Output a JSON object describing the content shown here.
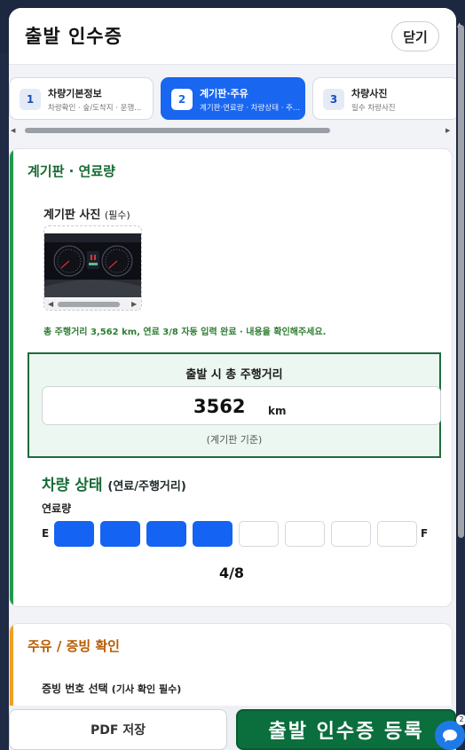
{
  "modal": {
    "title": "출발 인수증",
    "close_label": "닫기"
  },
  "steps": [
    {
      "num": "1",
      "title": "차량기본정보",
      "sub": "차량확인 · 숲/도착지 · 운행...",
      "active": false
    },
    {
      "num": "2",
      "title": "계기판·주유",
      "sub": "계기판·연료량 · 차량상태 · 주...",
      "active": true
    },
    {
      "num": "3",
      "title": "차량사진",
      "sub": "필수 차량사진",
      "active": false
    }
  ],
  "dashboard": {
    "section_title": "계기판 · 연료량",
    "photo_label": "계기판 사진",
    "photo_required": "(필수)",
    "ocr_note": "총 주행거리 3,562 km, 연료 3/8 자동 입력 완료 · 내용을 확인해주세요.",
    "odometer": {
      "title": "출발 시 총 주행거리",
      "value": "3562",
      "unit": "km",
      "caption": "(계기판 기준)"
    },
    "vehicle_status": {
      "title": "차량 상태",
      "subtitle": "(연료/주행거리)",
      "fuel_label": "연료량",
      "empty_label": "E",
      "full_label": "F",
      "fuel_level": 4,
      "fuel_segments": 8,
      "fuel_value_text": "4/8"
    }
  },
  "evidence": {
    "section_title": "주유 / 증빙 확인",
    "select_label": "증빙 번호 선택",
    "select_hint": "(기사 확인 필수)"
  },
  "footer": {
    "pdf_label": "PDF 저장",
    "submit_label": "출발 인수증 등록"
  },
  "chat_badge": "2",
  "colors": {
    "primary_blue": "#1966f0",
    "green": "#176b34",
    "submit_green": "#0b6e3d",
    "orange_accent": "#f0a020"
  }
}
